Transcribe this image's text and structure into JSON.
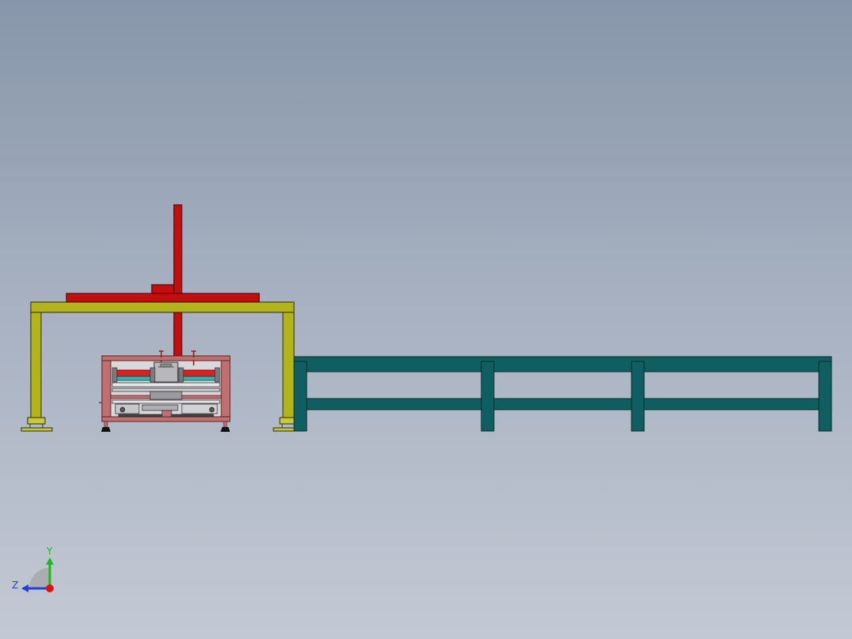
{
  "viewport": {
    "view": "cad-3d-model-front-view",
    "background_top": "#8796aa",
    "background_bottom": "#c3c9d4"
  },
  "model": {
    "colors": {
      "gantry_frame": "#b3b31a",
      "gantry_beam_red": "#c10f0f",
      "machine_frame": "#c07070",
      "roller_red": "#e02020",
      "roller_cyan": "#35b6b6",
      "conveyor_table": "#0f5f60"
    }
  },
  "triad": {
    "y_label": "Y",
    "z_label": "Z",
    "y_color": "#10c010",
    "z_color": "#2040e0",
    "x_color": "#e01010"
  }
}
